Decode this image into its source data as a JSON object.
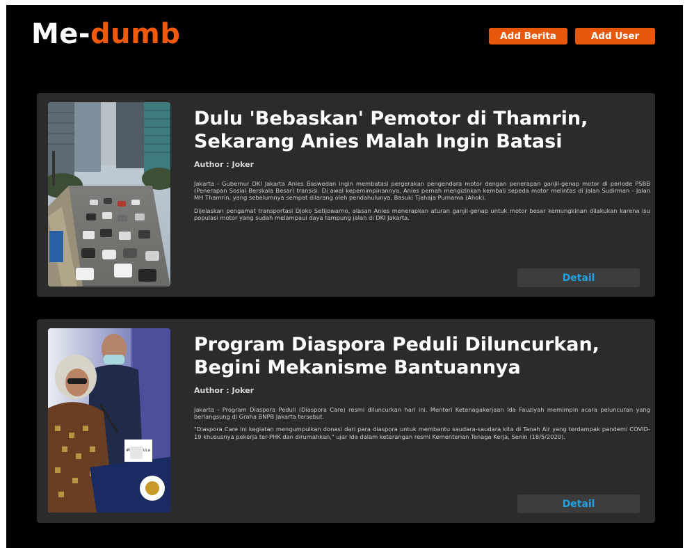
{
  "header": {
    "logo_part1": "Me-",
    "logo_part2": "dumb",
    "add_berita_label": "Add Berita",
    "add_user_label": "Add User"
  },
  "colors": {
    "accent": "#e8580c",
    "background": "#000000",
    "card": "#2b2b2b",
    "detail_text": "#1ea3e6"
  },
  "articles": [
    {
      "title": "Dulu 'Bebaskan' Pemotor di Thamrin, Sekarang Anies Malah Ingin Batasi",
      "author": "Author : Joker",
      "paragraphs": [
        "Jakarta - Gubernur DKI Jakarta Anies Baswedan ingin membatasi pergerakan pengendara motor dengan penerapan ganjil-genap motor di periode PSBB (Penerapan Sosial Berskala Besar) transisi. Di awal kepemimpinannya, Anies pernah mengizinkan kembali sepeda motor melintas di Jalan Sudirman - Jalan MH Thamrin, yang sebelumnya sempat dilarang oleh pendahulunya, Basuki Tjahaja Purnama (Ahok).",
        "Dijelaskan pengamat transportasi Djoko Setijowarno, alasan Anies menerapkan aturan ganjil-genap untuk motor besar kemungkinan dilakukan karena isu populasi motor yang sudah melampaui daya tampung jalan di DKI Jakarta."
      ],
      "detail_label": "Detail",
      "image": "traffic-street-photo"
    },
    {
      "title": "Program Diaspora Peduli Diluncurkan, Begini Mekanisme Bantuannya",
      "author": "Author : Joker",
      "paragraphs": [
        "Jakarta - Program Diaspora Peduli (Diaspora Care) resmi diluncurkan hari ini. Menteri Ketenagakerjaan Ida Fauziyah memimpin acara peluncuran yang berlangsung di Graha BNPB Jakarta tersebut.",
        "\"Diaspora Care ini kegiatan mengumpulkan donasi dari para diaspora untuk membantu saudara-saudara kita di Tanah Air yang terdampak pandemi COVID-19 khususnya pekerja ter-PHK dan dirumahkan,\" ujar Ida dalam keterangan resmi Kementerian Tenaga Kerja, Senin (18/5/2020)."
      ],
      "detail_label": "Detail",
      "image": "press-conference-photo",
      "image_caption": "#BersatuLa"
    }
  ]
}
